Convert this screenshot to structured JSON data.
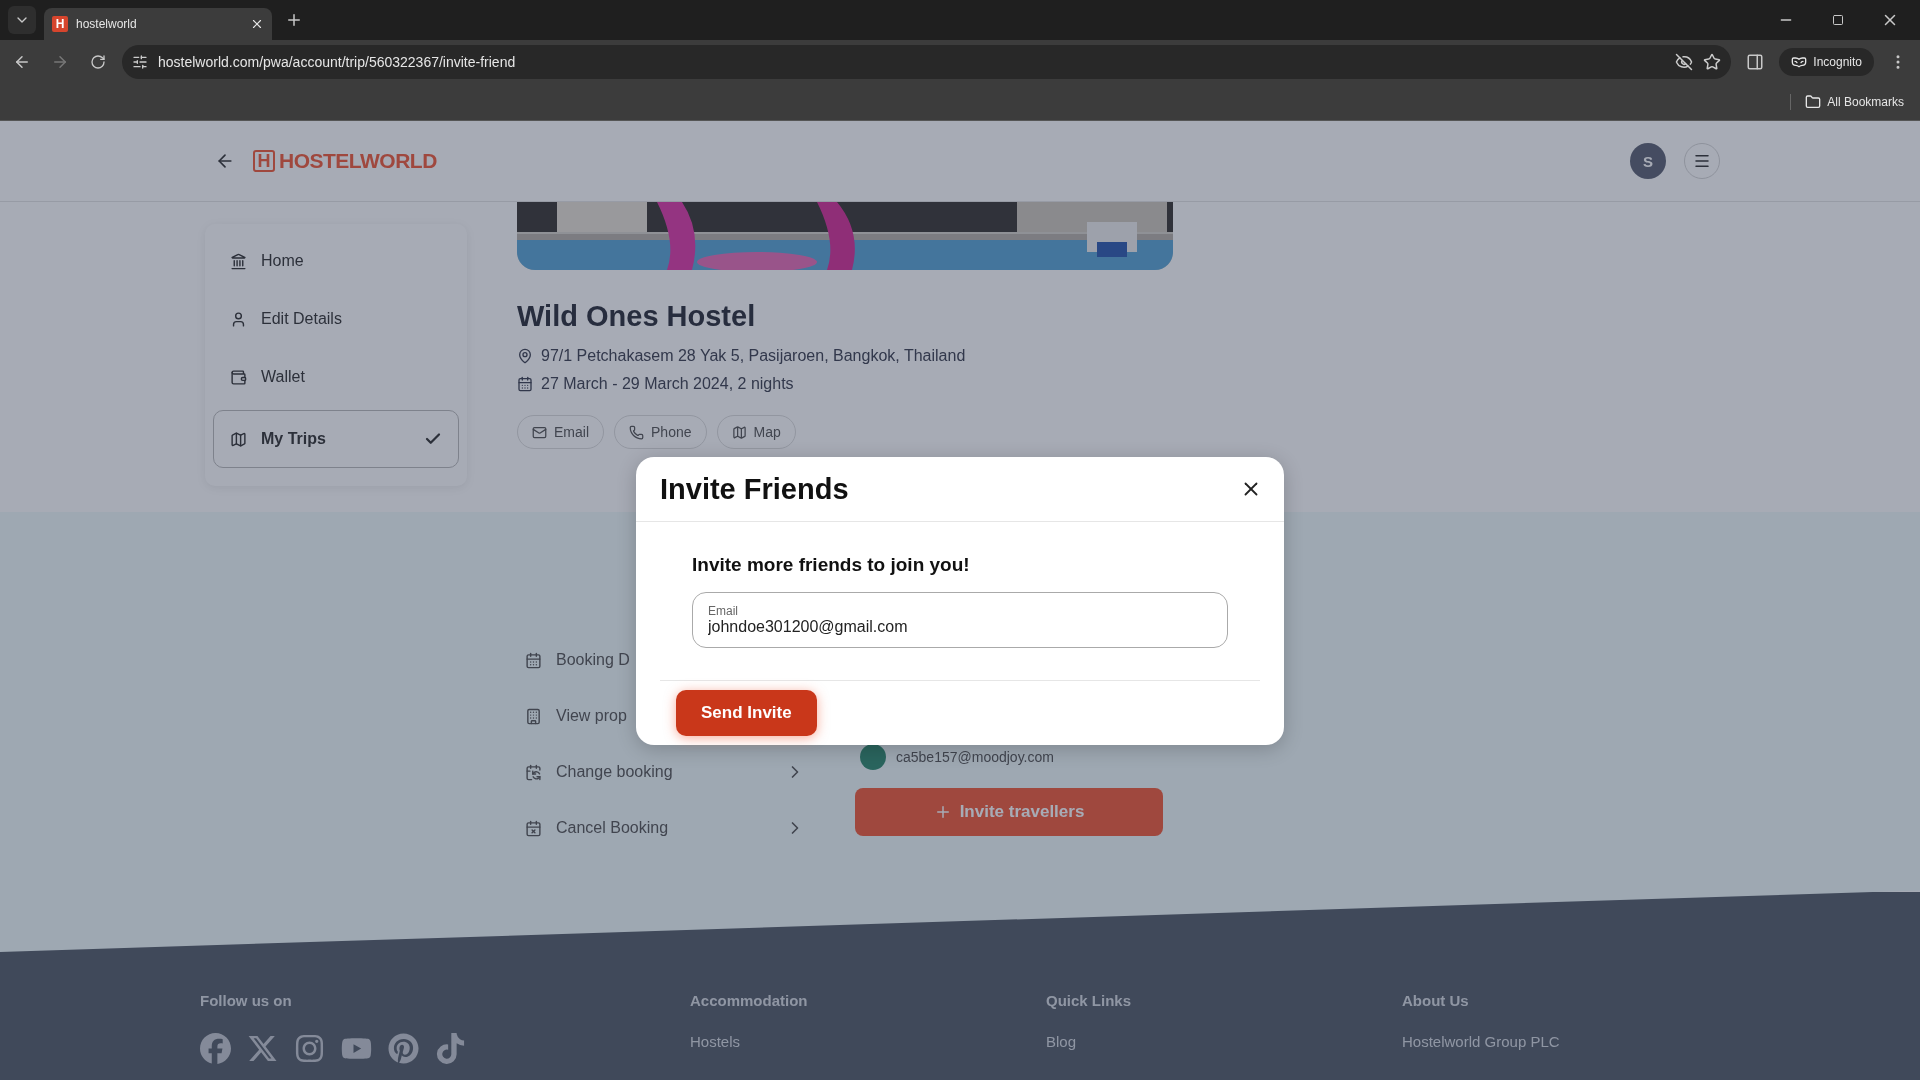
{
  "browser": {
    "tab": {
      "favicon": "H",
      "title": "hostelworld"
    },
    "url": "hostelworld.com/pwa/account/trip/560322367/invite-friend",
    "profile": "Incognito",
    "bookmarks": "All Bookmarks"
  },
  "header": {
    "logo_mark": "H",
    "logo": "HOSTELWORLD",
    "avatar": "S"
  },
  "sidebar": {
    "items": [
      {
        "label": "Home",
        "selected": false
      },
      {
        "label": "Edit Details",
        "selected": false
      },
      {
        "label": "Wallet",
        "selected": false
      },
      {
        "label": "My Trips",
        "selected": true
      }
    ]
  },
  "hostel": {
    "name": "Wild Ones Hostel",
    "address": "97/1 Petchakasem 28 Yak 5, Pasijaroen, Bangkok, Thailand",
    "dates": "27 March - 29 March 2024, 2 nights",
    "actions": [
      "Email",
      "Phone",
      "Map"
    ]
  },
  "booking_menu": [
    {
      "label": "Booking D"
    },
    {
      "label": "View prop"
    },
    {
      "label": "Change booking",
      "chevron": true
    },
    {
      "label": "Cancel Booking",
      "chevron": true
    }
  ],
  "travellers": {
    "email": "ca5be157@moodjoy.com",
    "invite_button": "Invite travellers"
  },
  "footer": {
    "columns": [
      {
        "heading": "Follow us on"
      },
      {
        "heading": "Accommodation",
        "links": [
          "Hostels"
        ]
      },
      {
        "heading": "Quick Links",
        "links": [
          "Blog"
        ]
      },
      {
        "heading": "About Us",
        "links": [
          "Hostelworld Group PLC"
        ]
      }
    ]
  },
  "modal": {
    "title": "Invite Friends",
    "subtitle": "Invite more friends to join you!",
    "field_label": "Email",
    "field_value": "johndoe301200@gmail.com",
    "button": "Send Invite"
  }
}
